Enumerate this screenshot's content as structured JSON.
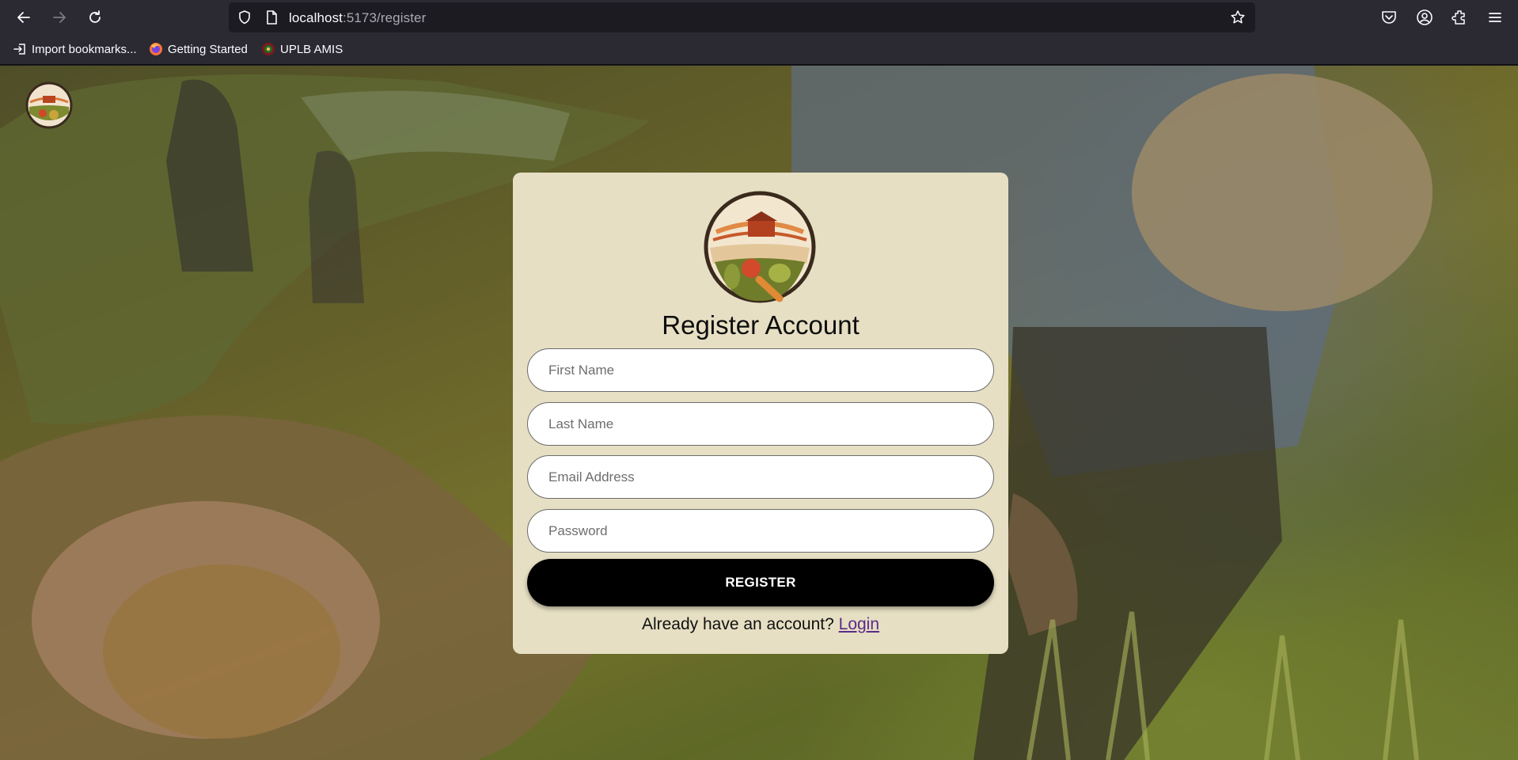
{
  "browser": {
    "url_host": "localhost",
    "url_path": ":5173/register",
    "bookmarks": [
      {
        "label": "Import bookmarks...",
        "icon": "import-icon"
      },
      {
        "label": "Getting Started",
        "icon": "firefox-icon"
      },
      {
        "label": "UPLB AMIS",
        "icon": "uplb-seal-icon"
      }
    ]
  },
  "register": {
    "title": "Register Account",
    "first_name_placeholder": "First Name",
    "last_name_placeholder": "Last Name",
    "email_placeholder": "Email Address",
    "password_placeholder": "Password",
    "submit_label": "REGISTER",
    "login_prompt": "Already have an account?",
    "login_link": "Login"
  },
  "colors": {
    "card_bg": "#e6dfc3",
    "button_bg": "#000000",
    "link": "#5b2b8a",
    "chrome_bg": "#2b2a33"
  }
}
